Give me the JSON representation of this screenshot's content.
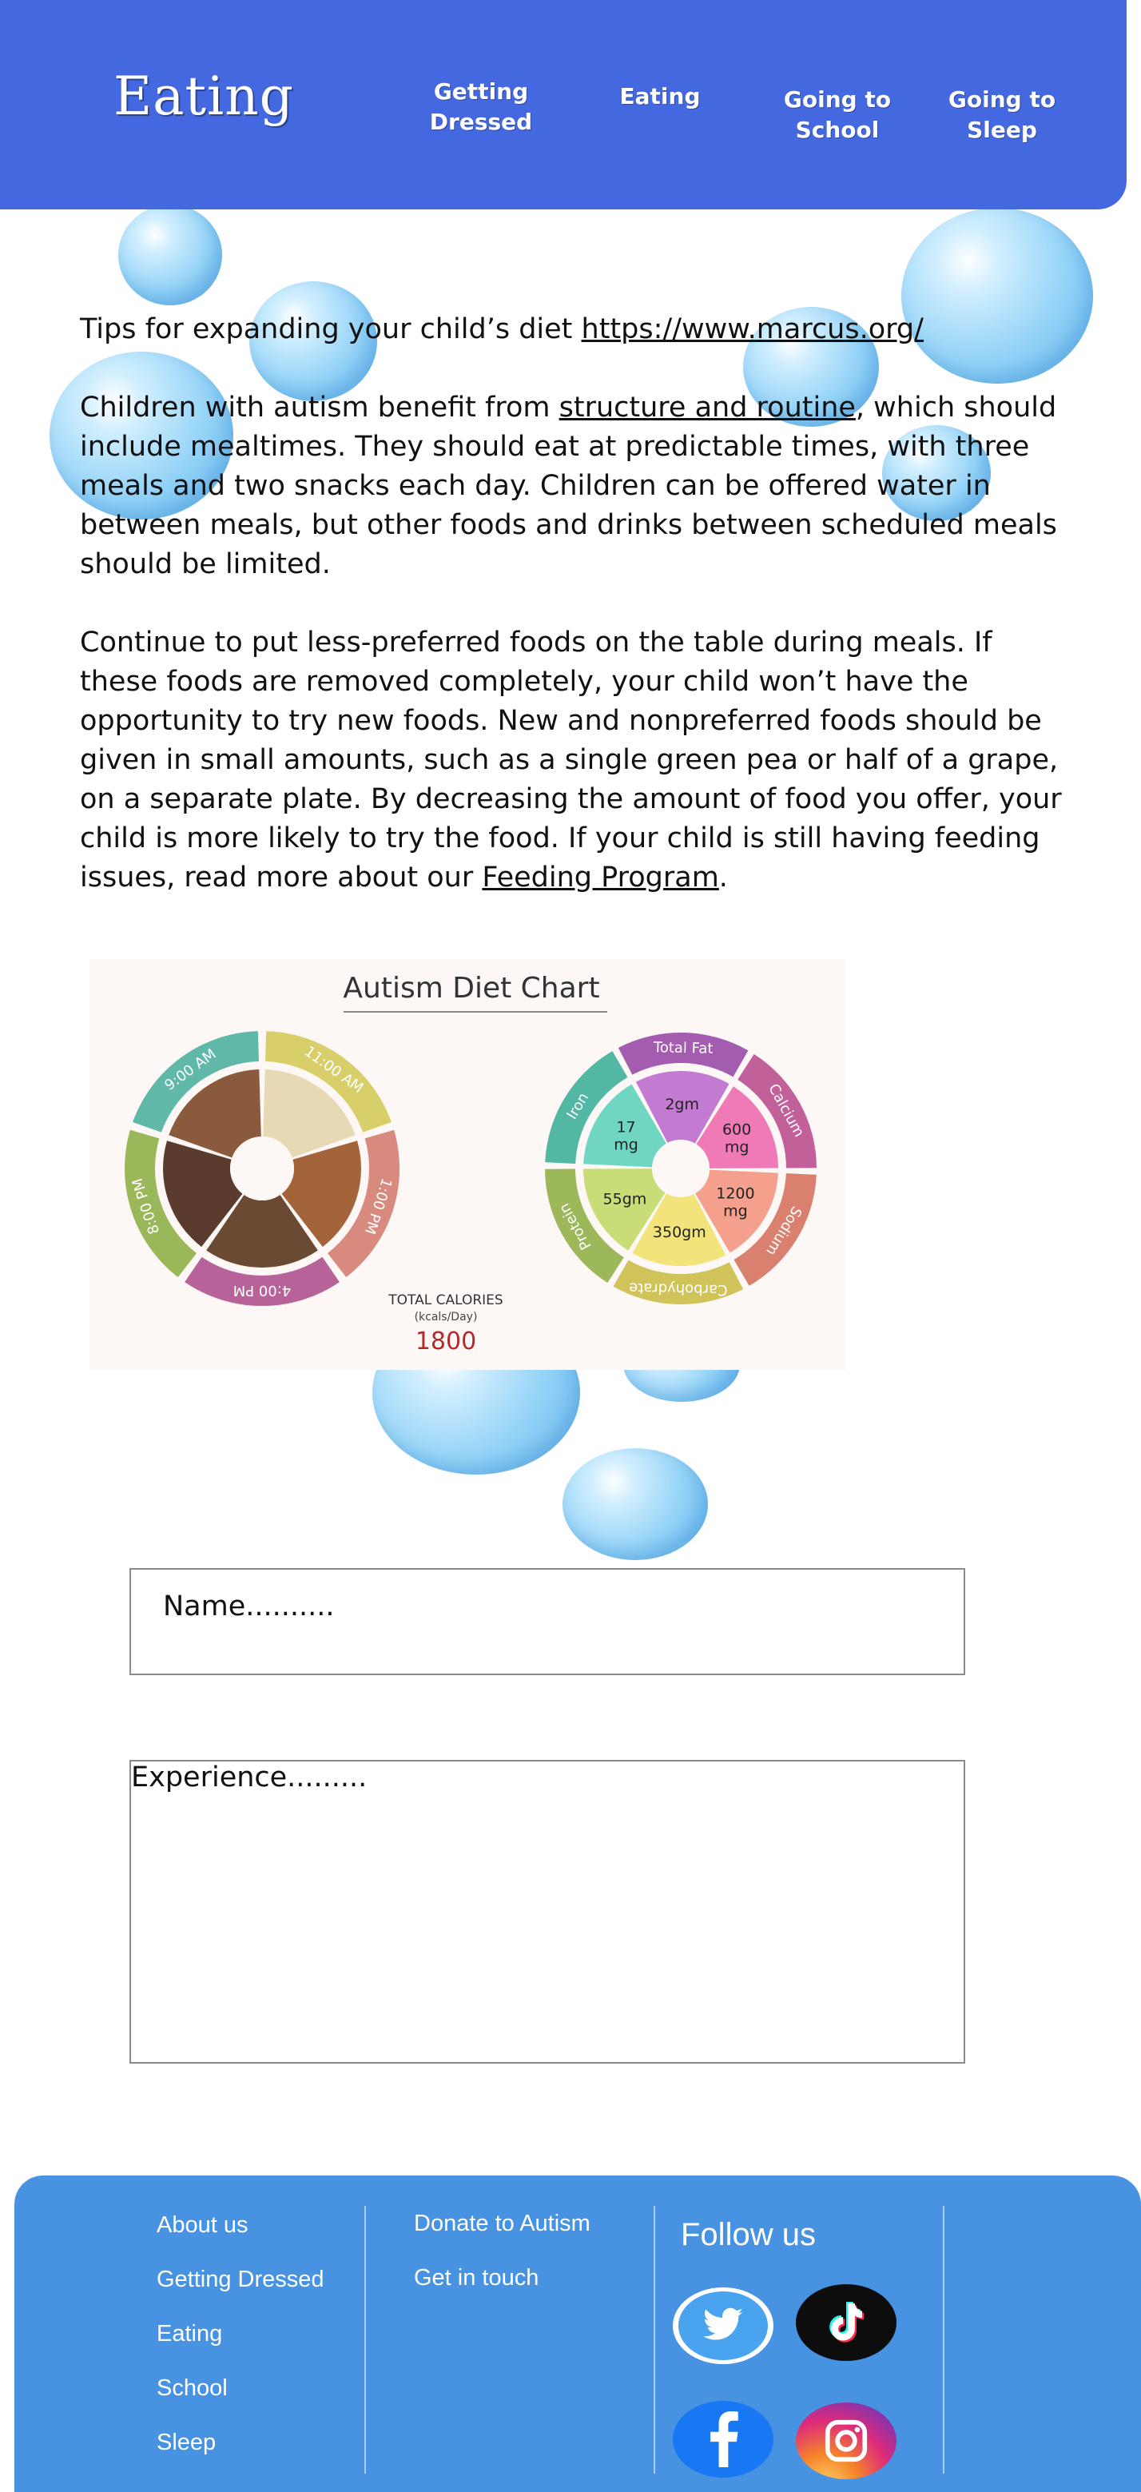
{
  "header": {
    "brand": "Eating",
    "nav": [
      {
        "line1": "Getting",
        "line2": "Dressed"
      },
      {
        "line1": "Eating",
        "line2": ""
      },
      {
        "line1": "Going to",
        "line2": "School"
      },
      {
        "line1": "Going to",
        "line2": "Sleep"
      }
    ]
  },
  "content": {
    "tips_prefix": "Tips for expanding your child’s diet ",
    "tips_link": "https://www.marcus.org/",
    "p1_before": "Children with autism benefit from ",
    "p1_link": "structure and routine",
    "p1_after": ", which should include mealtimes. They should eat at predictable times, with three meals and two snacks each day. Children can be offered water in between meals, but other foods and drinks between scheduled meals should be limited.",
    "p2_before": "Continue to put less-preferred foods on the table during meals. If these foods are removed completely, your child won’t have the opportunity to try new foods. New and nonpreferred foods should be given in small amounts, such as a single green pea or half of a grape, on a separate plate. By decreasing the amount of food you offer, your child is more likely to try the food. If your child is still having feeding issues, read more about our ",
    "p2_link": "Feeding Program",
    "p2_after": "."
  },
  "chart": {
    "title": "Autism Diet Chart",
    "times": [
      "9:00 AM",
      "11:00 AM",
      "1:00 PM",
      "4:00 PM",
      "8:00 PM"
    ],
    "time_colors": [
      "#5fb8a8",
      "#d9cf6a",
      "#d98a7e",
      "#b8629a",
      "#9ab85a"
    ],
    "nutrients": [
      {
        "name": "Total Fat",
        "value": "2gm",
        "color": "#c27bd1",
        "ring": "#a45cb0"
      },
      {
        "name": "Calcium",
        "value": "600 mg",
        "color": "#f07ab8",
        "ring": "#c2609a"
      },
      {
        "name": "Sodium",
        "value": "1200 mg",
        "color": "#f5a08c",
        "ring": "#d9806e"
      },
      {
        "name": "Carbohydrate",
        "value": "350gm",
        "color": "#f2e37a",
        "ring": "#cfc35a"
      },
      {
        "name": "Protein",
        "value": "55gm",
        "color": "#c8dc78",
        "ring": "#9cb85a"
      },
      {
        "name": "Iron",
        "value": "17 mg",
        "color": "#6fd6c2",
        "ring": "#52b8a4"
      }
    ],
    "total_label": "TOTAL CALORIES",
    "total_unit": "(kcals/Day)",
    "total_value": "1800"
  },
  "form": {
    "name_placeholder": "Name..........",
    "experience_placeholder": "Experience........."
  },
  "footer": {
    "col1": [
      "About us",
      "Getting Dressed",
      "Eating",
      "School",
      "Sleep"
    ],
    "col2": [
      "Donate to Autism",
      "Get in touch"
    ],
    "follow": "Follow us",
    "socials": [
      "twitter-icon",
      "tiktok-icon",
      "facebook-icon",
      "instagram-icon"
    ]
  }
}
